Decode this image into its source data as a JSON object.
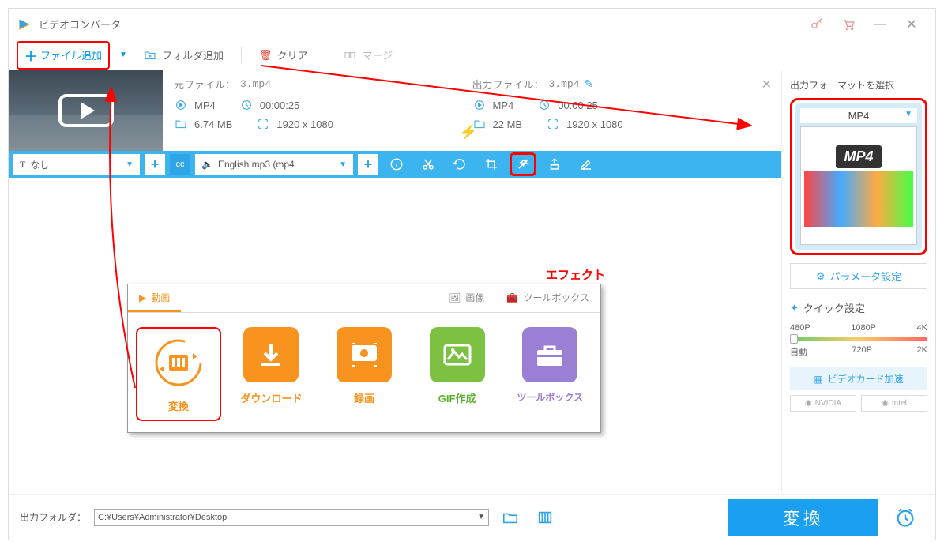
{
  "titlebar": {
    "title": "ビデオコンバータ"
  },
  "toolbar": {
    "add_file": "ファイル追加",
    "add_folder": "フォルダ追加",
    "clear": "クリア",
    "merge": "マージ"
  },
  "file": {
    "source_label": "元ファイル：",
    "source_name": "3.mp4",
    "output_label": "出力ファイル：",
    "output_name": "3.mp4",
    "src": {
      "format": "MP4",
      "duration": "00:00:25",
      "size": "6.74 MB",
      "resolution": "1920 x 1080"
    },
    "dst": {
      "format": "MP4",
      "duration": "00:00:25",
      "size": "22 MB",
      "resolution": "1920 x 1080"
    }
  },
  "bluebar": {
    "subtitle_none": "なし",
    "audio_track": "English mp3 (mp4",
    "effect_annotation": "エフェクト"
  },
  "tools": {
    "tabs": {
      "video": "動画",
      "image": "画像",
      "toolbox": "ツールボックス"
    },
    "cards": {
      "convert": "変換",
      "download": "ダウンロード",
      "record": "録画",
      "gif": "GIF作成",
      "toolbox": "ツールボックス"
    }
  },
  "right": {
    "header": "出力フォーマットを選択",
    "format_label": "MP4",
    "format_badge": "MP4",
    "param_settings": "パラメータ設定",
    "quick_settings": "クイック設定",
    "res": {
      "r480": "480P",
      "r1080": "1080P",
      "r4k": "4K",
      "auto": "自動",
      "r720": "720P",
      "r2k": "2K"
    },
    "gpu_accel": "ビデオカード加速",
    "gpu_nvidia": "NVIDIA",
    "gpu_intel": "Intel"
  },
  "bottom": {
    "output_folder_label": "出力フォルダ：",
    "output_folder_path": "C:¥Users¥Administrator¥Desktop",
    "convert": "変換"
  }
}
